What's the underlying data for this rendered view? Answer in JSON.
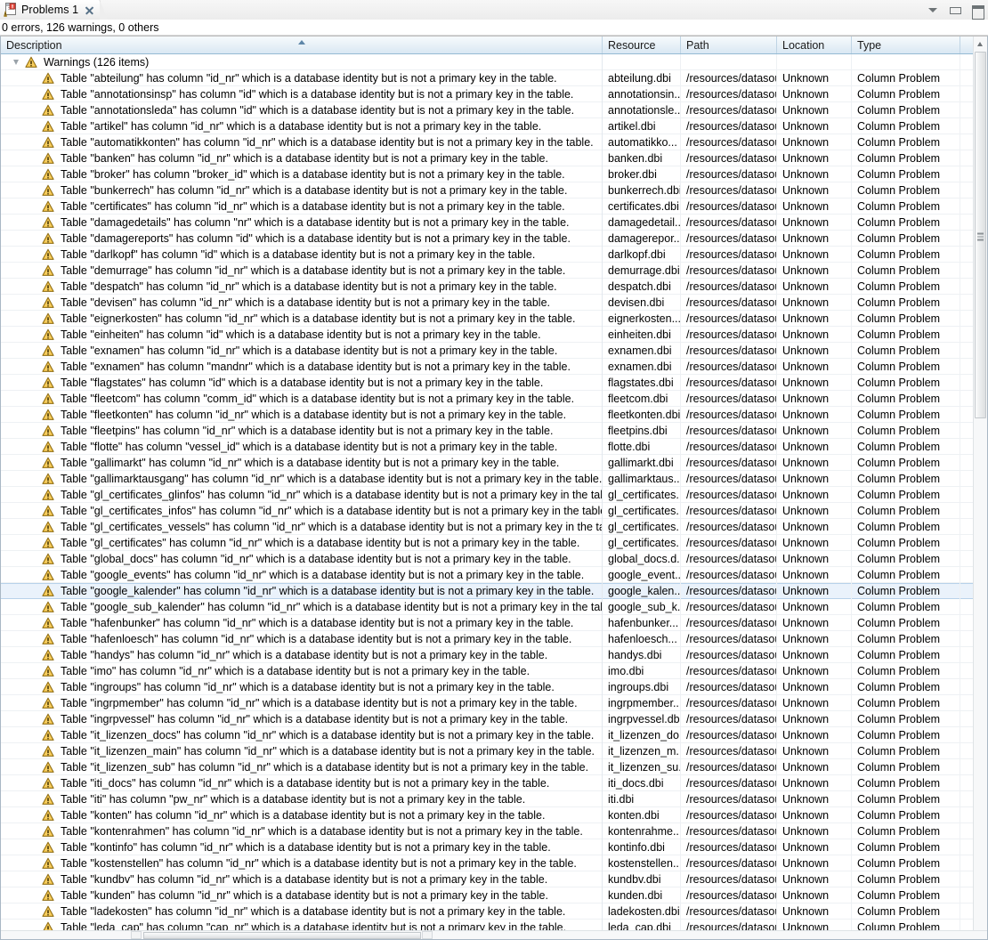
{
  "tab": {
    "title": "Problems 1",
    "icon": "problems-view-icon",
    "close_icon": "close-icon"
  },
  "view_toolbar": {
    "menu_icon": "view-menu-chevron-down-icon",
    "minimize_icon": "minimize-icon",
    "maximize_icon": "maximize-icon"
  },
  "status_line": "0 errors, 126 warnings, 0 others",
  "columns": [
    {
      "key": "description",
      "label": "Description",
      "sorted": true
    },
    {
      "key": "resource",
      "label": "Resource",
      "sorted": false
    },
    {
      "key": "path",
      "label": "Path",
      "sorted": false
    },
    {
      "key": "location",
      "label": "Location",
      "sorted": false
    },
    {
      "key": "type",
      "label": "Type",
      "sorted": false
    }
  ],
  "group": {
    "label": "Warnings (126 items)",
    "icon": "warning-icon",
    "expanded": true
  },
  "path_value": "/resources/datasou...",
  "location_value": "Unknown",
  "type_value": "Column Problem",
  "rows": [
    {
      "description": "Table \"abteilung\" has column \"id_nr\" which is a database identity but is not a primary key in the table.",
      "resource": "abteilung.dbi",
      "path": "/resources/datasou...",
      "location": "Unknown",
      "type": "Column Problem",
      "selected": false
    },
    {
      "description": "Table \"annotationsinsp\" has column \"id\" which is a database identity but is not a primary key in the table.",
      "resource": "annotationsin...",
      "path": "/resources/datasou...",
      "location": "Unknown",
      "type": "Column Problem",
      "selected": false
    },
    {
      "description": "Table \"annotationsleda\" has column \"id\" which is a database identity but is not a primary key in the table.",
      "resource": "annotationsle...",
      "path": "/resources/datasou...",
      "location": "Unknown",
      "type": "Column Problem",
      "selected": false
    },
    {
      "description": "Table \"artikel\" has column \"id_nr\" which is a database identity but is not a primary key in the table.",
      "resource": "artikel.dbi",
      "path": "/resources/datasou...",
      "location": "Unknown",
      "type": "Column Problem",
      "selected": false
    },
    {
      "description": "Table \"automatikkonten\" has column \"id_nr\" which is a database identity but is not a primary key in the table.",
      "resource": "automatikko...",
      "path": "/resources/datasou...",
      "location": "Unknown",
      "type": "Column Problem",
      "selected": false
    },
    {
      "description": "Table \"banken\" has column \"id_nr\" which is a database identity but is not a primary key in the table.",
      "resource": "banken.dbi",
      "path": "/resources/datasou...",
      "location": "Unknown",
      "type": "Column Problem",
      "selected": false
    },
    {
      "description": "Table \"broker\" has column \"broker_id\" which is a database identity but is not a primary key in the table.",
      "resource": "broker.dbi",
      "path": "/resources/datasou...",
      "location": "Unknown",
      "type": "Column Problem",
      "selected": false
    },
    {
      "description": "Table \"bunkerrech\" has column \"id_nr\" which is a database identity but is not a primary key in the table.",
      "resource": "bunkerrech.dbi",
      "path": "/resources/datasou...",
      "location": "Unknown",
      "type": "Column Problem",
      "selected": false
    },
    {
      "description": "Table \"certificates\" has column \"id_nr\" which is a database identity but is not a primary key in the table.",
      "resource": "certificates.dbi",
      "path": "/resources/datasou...",
      "location": "Unknown",
      "type": "Column Problem",
      "selected": false
    },
    {
      "description": "Table \"damagedetails\" has column \"nr\" which is a database identity but is not a primary key in the table.",
      "resource": "damagedetail...",
      "path": "/resources/datasou...",
      "location": "Unknown",
      "type": "Column Problem",
      "selected": false
    },
    {
      "description": "Table \"damagereports\" has column \"id\" which is a database identity but is not a primary key in the table.",
      "resource": "damagerepor...",
      "path": "/resources/datasou...",
      "location": "Unknown",
      "type": "Column Problem",
      "selected": false
    },
    {
      "description": "Table \"darlkopf\" has column \"id\" which is a database identity but is not a primary key in the table.",
      "resource": "darlkopf.dbi",
      "path": "/resources/datasou...",
      "location": "Unknown",
      "type": "Column Problem",
      "selected": false
    },
    {
      "description": "Table \"demurrage\" has column \"id_nr\" which is a database identity but is not a primary key in the table.",
      "resource": "demurrage.dbi",
      "path": "/resources/datasou...",
      "location": "Unknown",
      "type": "Column Problem",
      "selected": false
    },
    {
      "description": "Table \"despatch\" has column \"id_nr\" which is a database identity but is not a primary key in the table.",
      "resource": "despatch.dbi",
      "path": "/resources/datasou...",
      "location": "Unknown",
      "type": "Column Problem",
      "selected": false
    },
    {
      "description": "Table \"devisen\" has column \"id_nr\" which is a database identity but is not a primary key in the table.",
      "resource": "devisen.dbi",
      "path": "/resources/datasou...",
      "location": "Unknown",
      "type": "Column Problem",
      "selected": false
    },
    {
      "description": "Table \"eignerkosten\" has column \"id_nr\" which is a database identity but is not a primary key in the table.",
      "resource": "eignerkosten....",
      "path": "/resources/datasou...",
      "location": "Unknown",
      "type": "Column Problem",
      "selected": false
    },
    {
      "description": "Table \"einheiten\" has column \"id\" which is a database identity but is not a primary key in the table.",
      "resource": "einheiten.dbi",
      "path": "/resources/datasou...",
      "location": "Unknown",
      "type": "Column Problem",
      "selected": false
    },
    {
      "description": "Table \"exnamen\" has column \"id_nr\" which is a database identity but is not a primary key in the table.",
      "resource": "exnamen.dbi",
      "path": "/resources/datasou...",
      "location": "Unknown",
      "type": "Column Problem",
      "selected": false
    },
    {
      "description": "Table \"exnamen\" has column \"mandnr\" which is a database identity but is not a primary key in the table.",
      "resource": "exnamen.dbi",
      "path": "/resources/datasou...",
      "location": "Unknown",
      "type": "Column Problem",
      "selected": false
    },
    {
      "description": "Table \"flagstates\" has column \"id\" which is a database identity but is not a primary key in the table.",
      "resource": "flagstates.dbi",
      "path": "/resources/datasou...",
      "location": "Unknown",
      "type": "Column Problem",
      "selected": false
    },
    {
      "description": "Table \"fleetcom\" has column \"comm_id\" which is a database identity but is not a primary key in the table.",
      "resource": "fleetcom.dbi",
      "path": "/resources/datasou...",
      "location": "Unknown",
      "type": "Column Problem",
      "selected": false
    },
    {
      "description": "Table \"fleetkonten\" has column \"id_nr\" which is a database identity but is not a primary key in the table.",
      "resource": "fleetkonten.dbi",
      "path": "/resources/datasou...",
      "location": "Unknown",
      "type": "Column Problem",
      "selected": false
    },
    {
      "description": "Table \"fleetpins\" has column \"id_nr\" which is a database identity but is not a primary key in the table.",
      "resource": "fleetpins.dbi",
      "path": "/resources/datasou...",
      "location": "Unknown",
      "type": "Column Problem",
      "selected": false
    },
    {
      "description": "Table \"flotte\" has column \"vessel_id\" which is a database identity but is not a primary key in the table.",
      "resource": "flotte.dbi",
      "path": "/resources/datasou...",
      "location": "Unknown",
      "type": "Column Problem",
      "selected": false
    },
    {
      "description": "Table \"gallimarkt\" has column \"id_nr\" which is a database identity but is not a primary key in the table.",
      "resource": "gallimarkt.dbi",
      "path": "/resources/datasou...",
      "location": "Unknown",
      "type": "Column Problem",
      "selected": false
    },
    {
      "description": "Table \"gallimarktausgang\" has column \"id_nr\" which is a database identity but is not a primary key in the table.",
      "resource": "gallimarktaus...",
      "path": "/resources/datasou...",
      "location": "Unknown",
      "type": "Column Problem",
      "selected": false
    },
    {
      "description": "Table \"gl_certificates_glinfos\" has column \"id_nr\" which is a database identity but is not a primary key in the table.",
      "resource": "gl_certificates...",
      "path": "/resources/datasou...",
      "location": "Unknown",
      "type": "Column Problem",
      "selected": false
    },
    {
      "description": "Table \"gl_certificates_infos\" has column \"id_nr\" which is a database identity but is not a primary key in the table.",
      "resource": "gl_certificates...",
      "path": "/resources/datasou...",
      "location": "Unknown",
      "type": "Column Problem",
      "selected": false
    },
    {
      "description": "Table \"gl_certificates_vessels\" has column \"id_nr\" which is a database identity but is not a primary key in the table.",
      "resource": "gl_certificates...",
      "path": "/resources/datasou...",
      "location": "Unknown",
      "type": "Column Problem",
      "selected": false
    },
    {
      "description": "Table \"gl_certificates\" has column \"id_nr\" which is a database identity but is not a primary key in the table.",
      "resource": "gl_certificates...",
      "path": "/resources/datasou...",
      "location": "Unknown",
      "type": "Column Problem",
      "selected": false
    },
    {
      "description": "Table \"global_docs\" has column \"id_nr\" which is a database identity but is not a primary key in the table.",
      "resource": "global_docs.d...",
      "path": "/resources/datasou...",
      "location": "Unknown",
      "type": "Column Problem",
      "selected": false
    },
    {
      "description": "Table \"google_events\" has column \"id_nr\" which is a database identity but is not a primary key in the table.",
      "resource": "google_event...",
      "path": "/resources/datasou...",
      "location": "Unknown",
      "type": "Column Problem",
      "selected": false
    },
    {
      "description": "Table \"google_kalender\" has column \"id_nr\" which is a database identity but is not a primary key in the table.",
      "resource": "google_kalen...",
      "path": "/resources/datasou...",
      "location": "Unknown",
      "type": "Column Problem",
      "selected": true
    },
    {
      "description": "Table \"google_sub_kalender\" has column \"id_nr\" which is a database identity but is not a primary key in the table.",
      "resource": "google_sub_k...",
      "path": "/resources/datasou...",
      "location": "Unknown",
      "type": "Column Problem",
      "selected": false
    },
    {
      "description": "Table \"hafenbunker\" has column \"id_nr\" which is a database identity but is not a primary key in the table.",
      "resource": "hafenbunker...",
      "path": "/resources/datasou...",
      "location": "Unknown",
      "type": "Column Problem",
      "selected": false
    },
    {
      "description": "Table \"hafenloesch\" has column \"id_nr\" which is a database identity but is not a primary key in the table.",
      "resource": "hafenloesch...",
      "path": "/resources/datasou...",
      "location": "Unknown",
      "type": "Column Problem",
      "selected": false
    },
    {
      "description": "Table \"handys\" has column \"id_nr\" which is a database identity but is not a primary key in the table.",
      "resource": "handys.dbi",
      "path": "/resources/datasou...",
      "location": "Unknown",
      "type": "Column Problem",
      "selected": false
    },
    {
      "description": "Table \"imo\" has column \"id_nr\" which is a database identity but is not a primary key in the table.",
      "resource": "imo.dbi",
      "path": "/resources/datasou...",
      "location": "Unknown",
      "type": "Column Problem",
      "selected": false
    },
    {
      "description": "Table \"ingroups\" has column \"id_nr\" which is a database identity but is not a primary key in the table.",
      "resource": "ingroups.dbi",
      "path": "/resources/datasou...",
      "location": "Unknown",
      "type": "Column Problem",
      "selected": false
    },
    {
      "description": "Table \"ingrpmember\" has column \"id_nr\" which is a database identity but is not a primary key in the table.",
      "resource": "ingrpmember...",
      "path": "/resources/datasou...",
      "location": "Unknown",
      "type": "Column Problem",
      "selected": false
    },
    {
      "description": "Table \"ingrpvessel\" has column \"id_nr\" which is a database identity but is not a primary key in the table.",
      "resource": "ingrpvessel.dbi",
      "path": "/resources/datasou...",
      "location": "Unknown",
      "type": "Column Problem",
      "selected": false
    },
    {
      "description": "Table \"it_lizenzen_docs\" has column \"id_nr\" which is a database identity but is not a primary key in the table.",
      "resource": "it_lizenzen_do...",
      "path": "/resources/datasou...",
      "location": "Unknown",
      "type": "Column Problem",
      "selected": false
    },
    {
      "description": "Table \"it_lizenzen_main\" has column \"id_nr\" which is a database identity but is not a primary key in the table.",
      "resource": "it_lizenzen_m...",
      "path": "/resources/datasou...",
      "location": "Unknown",
      "type": "Column Problem",
      "selected": false
    },
    {
      "description": "Table \"it_lizenzen_sub\" has column \"id_nr\" which is a database identity but is not a primary key in the table.",
      "resource": "it_lizenzen_su...",
      "path": "/resources/datasou...",
      "location": "Unknown",
      "type": "Column Problem",
      "selected": false
    },
    {
      "description": "Table \"iti_docs\" has column \"id_nr\" which is a database identity but is not a primary key in the table.",
      "resource": "iti_docs.dbi",
      "path": "/resources/datasou...",
      "location": "Unknown",
      "type": "Column Problem",
      "selected": false
    },
    {
      "description": "Table \"iti\" has column \"pw_nr\" which is a database identity but is not a primary key in the table.",
      "resource": "iti.dbi",
      "path": "/resources/datasou...",
      "location": "Unknown",
      "type": "Column Problem",
      "selected": false
    },
    {
      "description": "Table \"konten\" has column \"id_nr\" which is a database identity but is not a primary key in the table.",
      "resource": "konten.dbi",
      "path": "/resources/datasou...",
      "location": "Unknown",
      "type": "Column Problem",
      "selected": false
    },
    {
      "description": "Table \"kontenrahmen\" has column \"id_nr\" which is a database identity but is not a primary key in the table.",
      "resource": "kontenrahme...",
      "path": "/resources/datasou...",
      "location": "Unknown",
      "type": "Column Problem",
      "selected": false
    },
    {
      "description": "Table \"kontinfo\" has column \"id_nr\" which is a database identity but is not a primary key in the table.",
      "resource": "kontinfo.dbi",
      "path": "/resources/datasou...",
      "location": "Unknown",
      "type": "Column Problem",
      "selected": false
    },
    {
      "description": "Table \"kostenstellen\" has column \"id_nr\" which is a database identity but is not a primary key in the table.",
      "resource": "kostenstellen....",
      "path": "/resources/datasou...",
      "location": "Unknown",
      "type": "Column Problem",
      "selected": false
    },
    {
      "description": "Table \"kundbv\" has column \"id_nr\" which is a database identity but is not a primary key in the table.",
      "resource": "kundbv.dbi",
      "path": "/resources/datasou...",
      "location": "Unknown",
      "type": "Column Problem",
      "selected": false
    },
    {
      "description": "Table \"kunden\" has column \"id_nr\" which is a database identity but is not a primary key in the table.",
      "resource": "kunden.dbi",
      "path": "/resources/datasou...",
      "location": "Unknown",
      "type": "Column Problem",
      "selected": false
    },
    {
      "description": "Table \"ladekosten\" has column \"id_nr\" which is a database identity but is not a primary key in the table.",
      "resource": "ladekosten.dbi",
      "path": "/resources/datasou...",
      "location": "Unknown",
      "type": "Column Problem",
      "selected": false
    },
    {
      "description": "Table \"leda_cap\" has column \"cap_nr\" which is a database identity but is not a primary key in the table.",
      "resource": "leda_cap.dbi",
      "path": "/resources/datasou...",
      "location": "Unknown",
      "type": "Column Problem",
      "selected": false
    }
  ],
  "scrollbars": {
    "vertical": {
      "up_icon": "scroll-up-arrow-icon",
      "down_icon": "scroll-down-arrow-icon"
    },
    "horizontal": {}
  },
  "colors": {
    "warning": "#f0b323",
    "selection": "#eaf2fb",
    "header": "#dbe9f4"
  }
}
